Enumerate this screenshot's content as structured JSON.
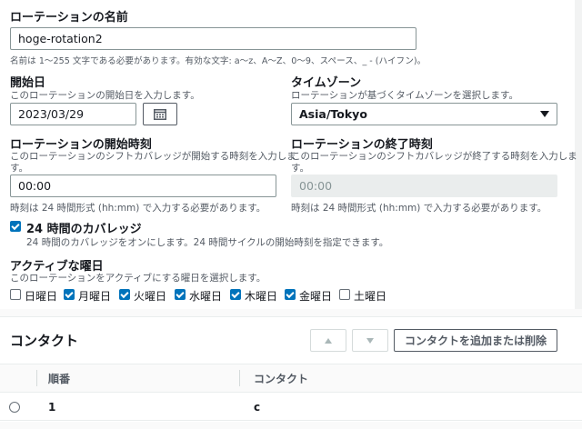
{
  "rotation_name": {
    "label": "ローテーションの名前",
    "value": "hoge-rotation2",
    "hint": "名前は 1〜255 文字である必要があります。有効な文字: a〜z、A〜Z、0〜9、スペース、_ - (ハイフン)。"
  },
  "start_date": {
    "label": "開始日",
    "desc": "このローテーションの開始日を入力します。",
    "value": "2023/03/29"
  },
  "timezone": {
    "label": "タイムゾーン",
    "desc": "ローテーションが基づくタイムゾーンを選択します。",
    "value": "Asia/Tokyo"
  },
  "start_time": {
    "label": "ローテーションの開始時刻",
    "desc_line1": "このローテーションのシフトカバレッジが開始する時刻を入力しま",
    "desc_line2": "す。",
    "value": "00:00",
    "hint": "時刻は 24 時間形式 (hh:mm) で入力する必要があります。"
  },
  "end_time": {
    "label": "ローテーションの終了時刻",
    "desc_line1": "このローテーションのシフトカバレッジが終了する時刻を入力しま",
    "desc_line2": "す。",
    "value": "00:00",
    "hint": "時刻は 24 時間形式 (hh:mm) で入力する必要があります。"
  },
  "coverage24": {
    "label": "24 時間のカバレッジ",
    "desc": "24 時間のカバレッジをオンにします。24 時間サイクルの開始時刻を指定できます。",
    "checked": true
  },
  "active_days": {
    "label": "アクティブな曜日",
    "desc": "このローテーションをアクティブにする曜日を選択します。",
    "days": [
      {
        "label": "日曜日",
        "checked": false
      },
      {
        "label": "月曜日",
        "checked": true
      },
      {
        "label": "火曜日",
        "checked": true
      },
      {
        "label": "水曜日",
        "checked": true
      },
      {
        "label": "木曜日",
        "checked": true
      },
      {
        "label": "金曜日",
        "checked": true
      },
      {
        "label": "土曜日",
        "checked": false
      }
    ]
  },
  "contacts": {
    "title": "コンタクト",
    "add_remove_label": "コンタクトを追加または削除",
    "columns": [
      "順番",
      "コンタクト"
    ],
    "rows": [
      {
        "order": "1",
        "contact": "c"
      }
    ]
  },
  "colors": {
    "accent": "#0073bb",
    "border": "#879596",
    "text": "#16191f",
    "muted": "#545b64"
  }
}
